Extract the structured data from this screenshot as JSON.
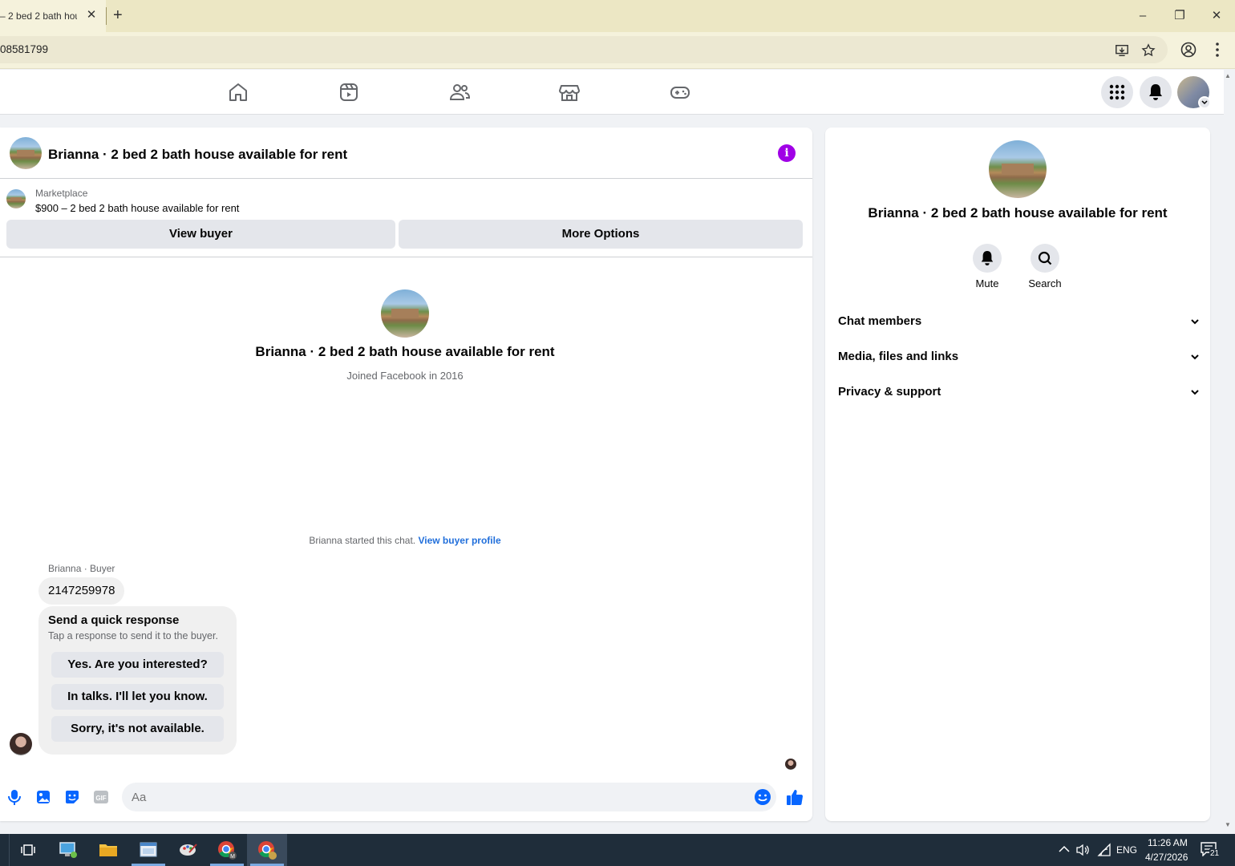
{
  "browser": {
    "tab_title": "– 2 bed 2 bath hou",
    "tab_close": "✕",
    "new_tab": "+",
    "url": "08581799",
    "window_controls": [
      "–",
      "❐",
      "✕"
    ]
  },
  "header": {
    "title": "Brianna · 2 bed 2 bath house available for rent",
    "info": "i"
  },
  "listing": {
    "label": "Marketplace",
    "text": "$900 – 2 bed 2 bath house available for rent",
    "view_buyer": "View buyer",
    "more_options": "More Options"
  },
  "intro": {
    "name": "Brianna · 2 bed 2 bath house available for rent",
    "joined": "Joined Facebook in 2016"
  },
  "thread": {
    "started_text": "Brianna started this chat.",
    "started_link": "View buyer profile",
    "sender_label": "Brianna · Buyer",
    "message": "2147259978",
    "quick_title": "Send a quick response",
    "quick_sub": "Tap a response to send it to the buyer.",
    "quick_responses": [
      "Yes. Are you interested?",
      "In talks. I'll let you know.",
      "Sorry, it's not available."
    ]
  },
  "composer": {
    "placeholder": "Aa"
  },
  "rpanel": {
    "name": "Brianna · 2 bed 2 bath house available for rent",
    "mute": "Mute",
    "search": "Search",
    "sections": [
      "Chat members",
      "Media, files and links",
      "Privacy & support"
    ]
  },
  "taskbar": {
    "lang": "ENG",
    "time": "11:26 AM",
    "date": "4/27/2026",
    "notifications": "21"
  },
  "colors": {
    "accent": "#0866ff",
    "info": "#a000e6",
    "link": "#216fdb",
    "tabstrip": "#ece7c4"
  }
}
